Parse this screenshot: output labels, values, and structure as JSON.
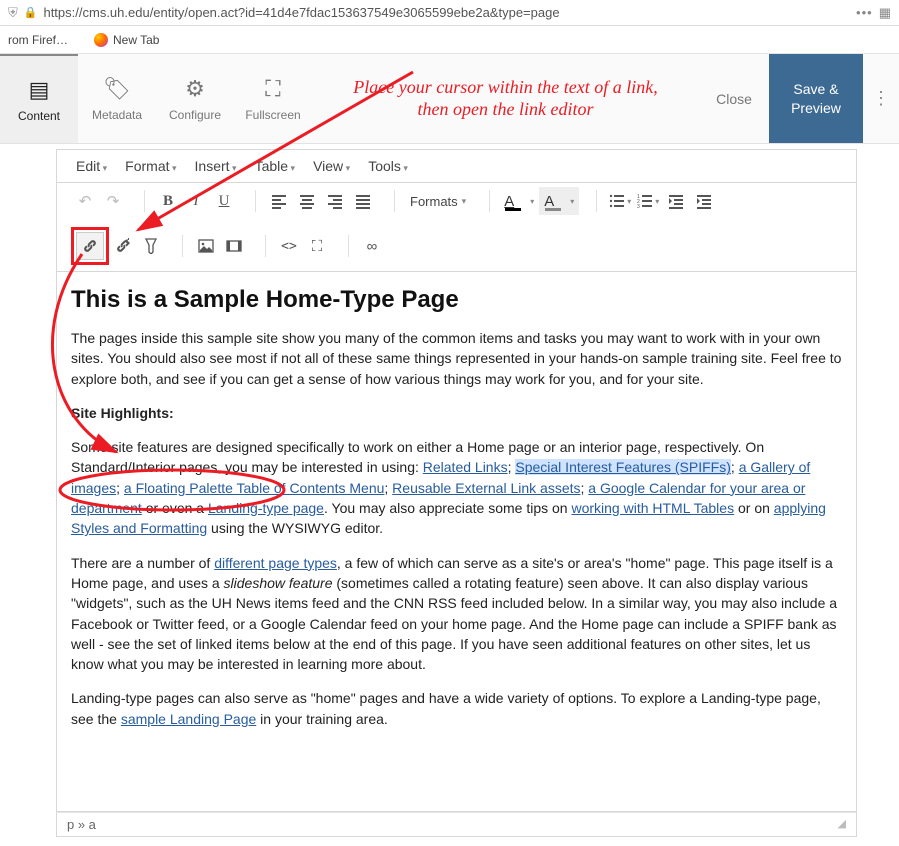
{
  "browser": {
    "url": "https://cms.uh.edu/entity/open.act?id=41d4e7fdac153637549e3065599ebe2a&type=page",
    "tabs": [
      "rom Firef…",
      "New Tab"
    ]
  },
  "toolbar": {
    "tabs": {
      "content": "Content",
      "metadata": "Metadata",
      "configure": "Configure",
      "fullscreen": "Fullscreen"
    },
    "close": "Close",
    "save": "Save & Preview"
  },
  "editor": {
    "menus": [
      "Edit",
      "Format",
      "Insert",
      "Table",
      "View",
      "Tools"
    ],
    "formats_label": "Formats",
    "statusbar": "p » a"
  },
  "content": {
    "heading": "This is a Sample Home-Type Page",
    "p1": "The pages inside this sample site show you many of the common items and tasks you may want to work with in your own sites. You should also see most if not all of these same things represented in your hands-on sample training site. Feel free to explore both, and see if you can get a sense of how various things may work for you, and for your site.",
    "highlights_label": "Site Highlights:",
    "p2a": "Some site features are designed specifically to work on either a Home page or an interior page, respectively. On Standard/Interior pages, you may be interested in using:  ",
    "links": {
      "related": "Related Links",
      "spiffs": "Special Interest Features (SPIFFs)",
      "gallery": "a Gallery of images",
      "floating": "a Floating Palette Table of Contents Menu",
      "reusable": "Reusable External Link assets",
      "gcal": "a Google Calendar for your area or department",
      "landing": "Landing-type page",
      "tables": "working with HTML Tables",
      "styles": "applying Styles and Formatting",
      "pagetypes": "different page types",
      "samplelanding": "sample Landing Page"
    },
    "p2b": " or even a ",
    "p2c": ". You may also appreciate some tips on ",
    "p2d": " or on ",
    "p2e": " using the WYSIWYG editor.",
    "p3a": "There are a number of ",
    "p3b": ", a few of which can serve as a site's or area's \"home\" page. This page itself is a Home page, and uses a ",
    "p3c": "slideshow feature",
    "p3d": " (sometimes called a rotating feature) seen above. It can also display various \"widgets\", such as the UH News items feed and the CNN RSS feed included below. In a similar way, you may also include a Facebook or Twitter feed, or a Google Calendar feed on your home page. And the Home page can include a SPIFF bank as well - see the set of linked items below at the end of this page. If you have seen additional features on other sites, let us know what you may be interested in learning more about.",
    "p4a": "Landing-type pages can also serve as \"home\" pages and have a wide variety of options. To explore a Landing-type page, see the ",
    "p4b": " in your training area."
  },
  "annotation": {
    "line1": "Place your cursor within the text of a link,",
    "line2": "then open the link editor"
  }
}
